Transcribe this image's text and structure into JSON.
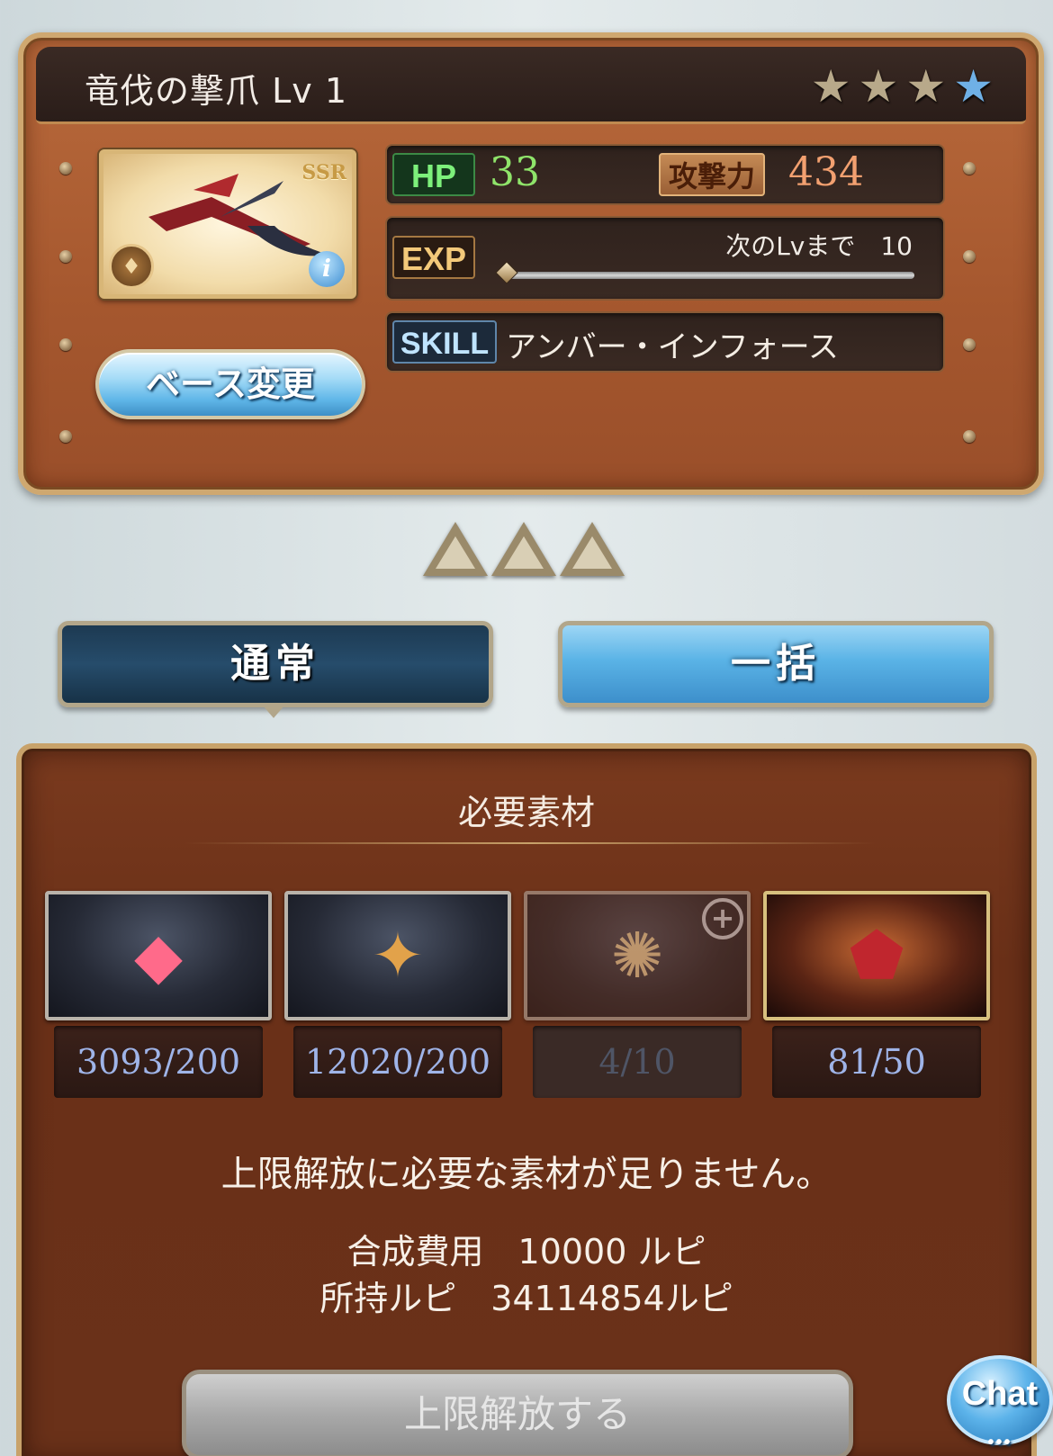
{
  "weapon": {
    "title": "竜伐の撃爪 Lv 1",
    "rarity": "SSR",
    "stars_total": 4,
    "stars_filled": 3,
    "hp_label": "HP",
    "hp_value": "33",
    "atk_label": "攻撃力",
    "atk_value": "434",
    "exp_label": "EXP",
    "exp_next_text": "次のLvまで　10",
    "exp_progress": 0,
    "skill_label": "SKILL",
    "skill_name": "アンバー・インフォース",
    "base_change_label": "ベース変更",
    "icons": {
      "element": "element-icon",
      "info": "info-icon"
    }
  },
  "uncap_indicators": 3,
  "modes": {
    "normal_label": "通常",
    "bulk_label": "一括",
    "selected": "normal"
  },
  "materials": {
    "title": "必要素材",
    "items": [
      {
        "name": "material-red-gem",
        "count": "3093/200",
        "dim": false,
        "icon": "red-crystal-icon"
      },
      {
        "name": "material-gold-ornament",
        "count": "12020/200",
        "dim": false,
        "icon": "gold-ornament-icon"
      },
      {
        "name": "material-light-orb",
        "count": "4/10",
        "dim": true,
        "icon": "light-orb-icon"
      },
      {
        "name": "material-red-shard",
        "count": "81/50",
        "dim": false,
        "icon": "red-shard-icon"
      }
    ],
    "warning": "上限解放に必要な素材が足りません。",
    "cost_line": "合成費用　10000 ルピ",
    "owned_line": "所持ルピ　34114854ルピ",
    "uncap_button_label": "上限解放する"
  },
  "chat": {
    "label": "Chat",
    "dots": "•••"
  },
  "colors": {
    "hp": "#8fe46a",
    "atk": "#f2a070",
    "count": "#9fb4e8",
    "panel": "#6a3018"
  }
}
